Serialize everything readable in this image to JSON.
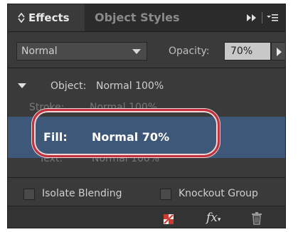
{
  "tabs": {
    "effects": "Effects",
    "object_styles": "Object Styles"
  },
  "blend_mode": "Normal",
  "opacity": {
    "label": "Opacity:",
    "value": "70%"
  },
  "list": {
    "object": {
      "label": "Object:",
      "value": "Normal 100%"
    },
    "stroke": {
      "label": "Stroke:",
      "value": "Normal 100%"
    },
    "fill": {
      "label": "Fill:",
      "value": "Normal 70%"
    },
    "text": {
      "label": "Text:",
      "value": "Normal 100%"
    }
  },
  "options": {
    "isolate_blending": "Isolate Blending",
    "knockout_group": "Knockout Group"
  },
  "toolbar": {
    "fx": "fx"
  },
  "icons": [
    "up-down-arrows-icon",
    "fast-forward-icon",
    "panel-menu-icon",
    "dropdown-arrow-icon",
    "disclosure-triangle-icon",
    "clear-effects-icon",
    "fx-icon",
    "trash-icon"
  ],
  "colors": {
    "panel_bg": "#3a3a3a",
    "selected_row": "#3d5879",
    "highlight_ring": "#c2323c"
  }
}
